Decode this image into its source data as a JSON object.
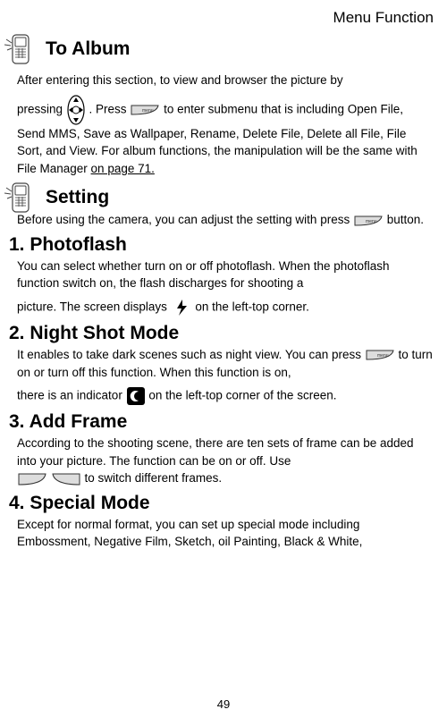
{
  "header": {
    "right": "Menu Function"
  },
  "sections": {
    "toAlbum": {
      "title": "To Album",
      "para1a": "After entering this section, to view and browser the picture by",
      "para1b": "pressing ",
      "para1c": ".    Press ",
      "para1d": " to enter submenu that is including Open File, Send MMS, Save as Wallpaper, Rename, Delete File, Delete all File, File Sort, and View.    For album functions, the manipulation will be the same with File Manager ",
      "link": "on page 71."
    },
    "setting": {
      "title": "Setting",
      "para1a": "Before using the camera, you can adjust the setting with press ",
      "para1b": " button."
    },
    "photoflash": {
      "title": "1. Photoflash",
      "para1a": "You can select whether turn on or off photoflash.    When the photoflash function switch on, the flash discharges for shooting a",
      "para1b": "picture.      The screen displays ",
      "para1c": " on the left-top corner."
    },
    "nightshot": {
      "title": "2. Night Shot Mode",
      "para1a": "It enables to take dark scenes such as night view.    You can press ",
      "para1b": " to turn on or turn off this function.    When this function is on,",
      "para1c": "there is an indicator ",
      "para1d": " on the left-top corner of the screen."
    },
    "addframe": {
      "title": "3. Add Frame",
      "para1a": "According to the shooting scene, there are ten sets of frame can be added into your picture.    The function can be on or off. Use ",
      "para1b": " to switch different frames."
    },
    "specialmode": {
      "title": "4. Special Mode",
      "para1": "Except for normal format, you can set up special mode including Embossment, Negative Film, Sketch, oil Painting, Black & White,"
    }
  },
  "pageNumber": "49"
}
